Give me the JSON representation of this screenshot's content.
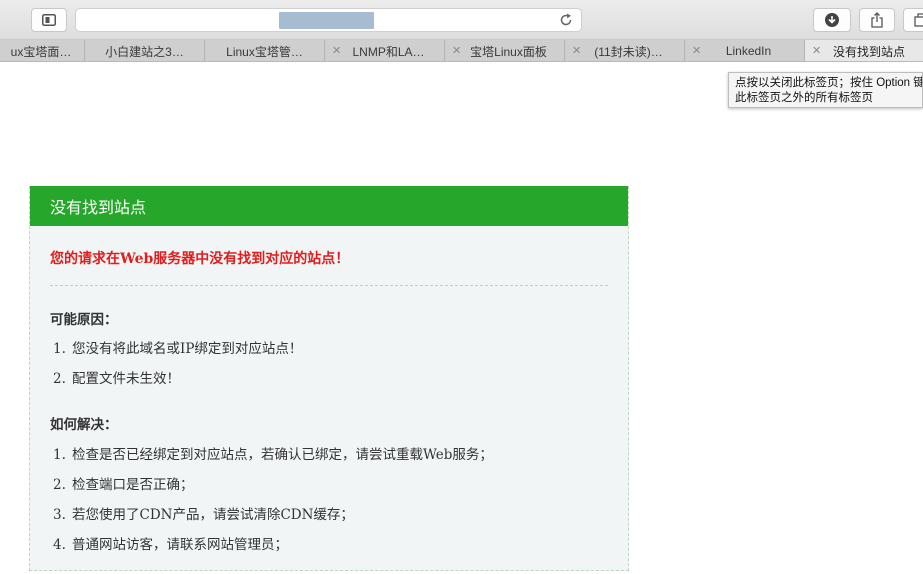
{
  "browser": {
    "url": "",
    "tabs": [
      {
        "label": "ux宝塔面…",
        "active": false,
        "show_close": false
      },
      {
        "label": "小白建站之3…",
        "active": false,
        "show_close": false
      },
      {
        "label": "Linux宝塔管…",
        "active": false,
        "show_close": false
      },
      {
        "label": "LNMP和LA…",
        "active": false,
        "show_close": true
      },
      {
        "label": "宝塔Linux面板",
        "active": false,
        "show_close": true
      },
      {
        "label": "(11封未读)…",
        "active": false,
        "show_close": true
      },
      {
        "label": "LinkedIn",
        "active": false,
        "show_close": true
      },
      {
        "label": "没有找到站点",
        "active": true,
        "show_close": true
      }
    ],
    "tab_close_glyph": "✕",
    "tooltip": {
      "line1": "点按以关闭此标签页；按住 Option 键",
      "line2": "此标签页之外的所有标签页"
    },
    "icons": {
      "sidebar": "sidebar-icon",
      "reload": "reload-icon",
      "download": "download-icon",
      "share": "share-icon",
      "tabs": "tabs-overview-icon"
    }
  },
  "page": {
    "header_title": "没有找到站点",
    "error_message": "您的请求在Web服务器中没有找到对应的站点！",
    "causes": {
      "title": "可能原因：",
      "items": [
        {
          "num": "1.",
          "text": "您没有将此域名或IP绑定到对应站点！"
        },
        {
          "num": "2.",
          "text": "配置文件未生效！"
        }
      ]
    },
    "solutions": {
      "title": "如何解决：",
      "items": [
        {
          "num": "1.",
          "text": "检查是否已经绑定到对应站点，若确认已绑定，请尝试重载Web服务；"
        },
        {
          "num": "2.",
          "text": "检查端口是否正确；"
        },
        {
          "num": "3.",
          "text": "若您使用了CDN产品，请尝试清除CDN缓存；"
        },
        {
          "num": "4.",
          "text": "普通网站访客，请联系网站管理员；"
        }
      ]
    },
    "colors": {
      "header_bg": "#26a62a",
      "error_text": "#e11d1d",
      "card_bg": "#f1f5f6"
    }
  }
}
